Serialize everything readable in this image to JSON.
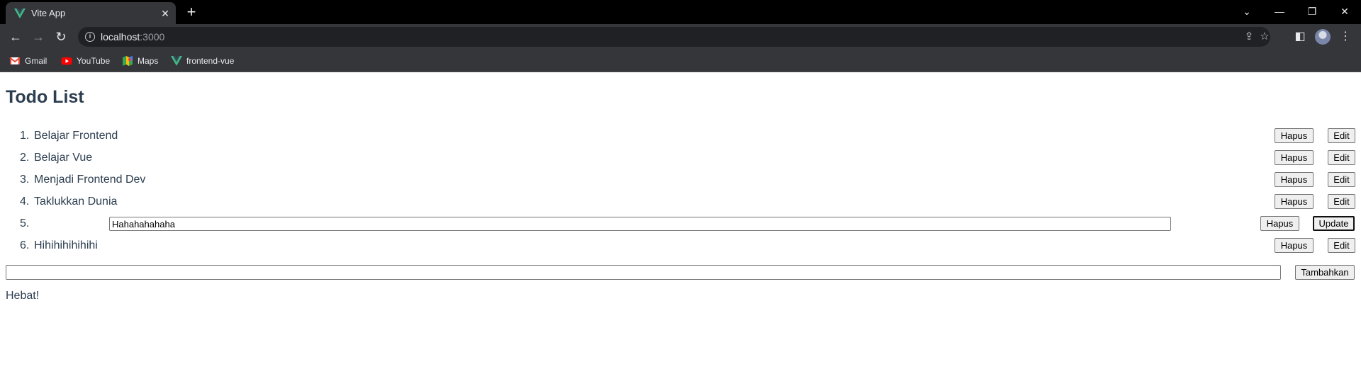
{
  "browser": {
    "tab_title": "Vite App",
    "new_tab_symbol": "+",
    "url_host": "localhost",
    "url_port": ":3000",
    "bookmarks": [
      {
        "label": "Gmail",
        "icon": "gmail-icon"
      },
      {
        "label": "YouTube",
        "icon": "youtube-icon"
      },
      {
        "label": "Maps",
        "icon": "maps-icon"
      },
      {
        "label": "frontend-vue",
        "icon": "vue-icon"
      }
    ],
    "colors": {
      "vue_green": "#41b883",
      "vue_dark": "#34495e",
      "chrome_dark": "#35363a"
    }
  },
  "page": {
    "title": "Todo List",
    "todos": [
      {
        "num": "1.",
        "text": "Belajar Frontend",
        "hapus": "Hapus",
        "edit": "Edit"
      },
      {
        "num": "2.",
        "text": "Belajar Vue",
        "hapus": "Hapus",
        "edit": "Edit"
      },
      {
        "num": "3.",
        "text": "Menjadi Frontend Dev",
        "hapus": "Hapus",
        "edit": "Edit"
      },
      {
        "num": "4.",
        "text": "Taklukkan Dunia",
        "hapus": "Hapus",
        "edit": "Edit"
      },
      {
        "num": "5.",
        "edit_value": "Hahahahahaha",
        "hapus": "Hapus",
        "update": "Update"
      },
      {
        "num": "6.",
        "text": "Hihihihihihihi",
        "hapus": "Hapus",
        "edit": "Edit"
      }
    ],
    "new_todo_value": "",
    "add_button": "Tambahkan",
    "status": "Hebat!",
    "text_color": "#2c3e50"
  }
}
